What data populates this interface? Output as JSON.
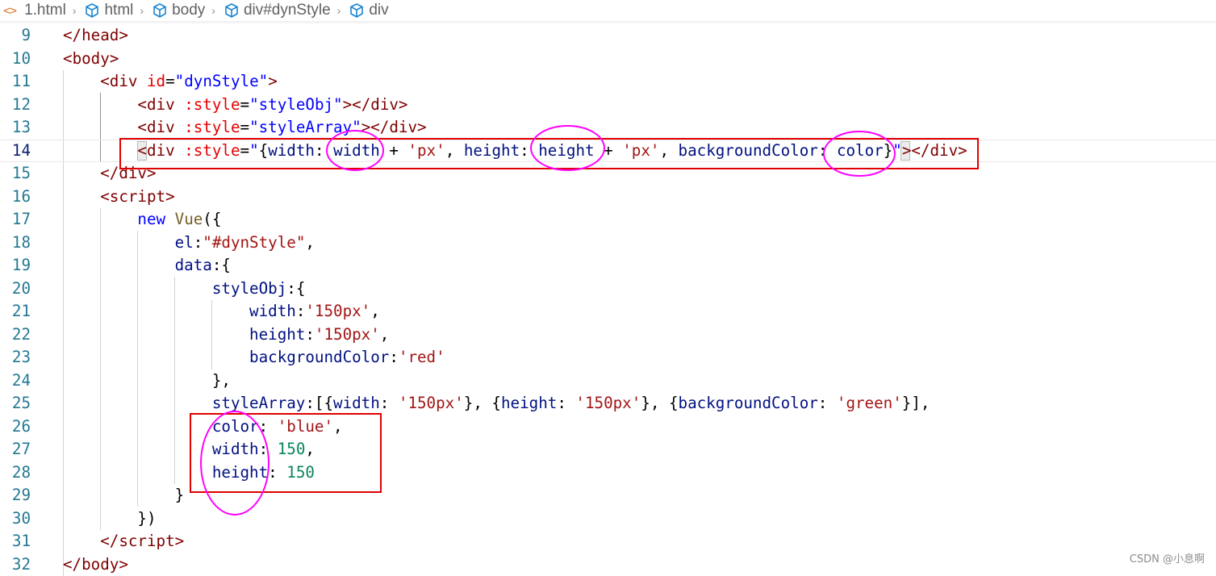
{
  "breadcrumb": {
    "file_icon": "<>",
    "file": "1.html",
    "items": [
      "html",
      "body",
      "div#dynStyle",
      "div"
    ],
    "separator": "›",
    "item_icon": "cube-icon"
  },
  "colors": {
    "tag": "#800000",
    "attribute": "#e50000",
    "attribute_value": "#0000ff",
    "keyword": "#0000ff",
    "function": "#795e26",
    "property": "#001080",
    "string": "#a31515",
    "number": "#098658",
    "line_number": "#237893",
    "annotation_box": "#e00000",
    "annotation_circle": "#ff00ff"
  },
  "editor": {
    "current_line": "14",
    "lines": [
      {
        "n": "9",
        "tokens": [
          [
            "</",
            "punc"
          ],
          [
            "head",
            "tag"
          ],
          [
            ">",
            "punc"
          ]
        ]
      },
      {
        "n": "10",
        "tokens": [
          [
            "<",
            "punc"
          ],
          [
            "body",
            "tag"
          ],
          [
            ">",
            "punc"
          ]
        ]
      },
      {
        "n": "11",
        "tokens": [
          [
            "    ",
            "plain"
          ],
          [
            "<",
            "punc"
          ],
          [
            "div",
            "tag"
          ],
          [
            " ",
            "plain"
          ],
          [
            "id",
            "attr"
          ],
          [
            "=",
            "plain"
          ],
          [
            "\"dynStyle\"",
            "str"
          ],
          [
            ">",
            "punc"
          ]
        ]
      },
      {
        "n": "12",
        "tokens": [
          [
            "        ",
            "plain"
          ],
          [
            "<",
            "punc"
          ],
          [
            "div",
            "tag"
          ],
          [
            " ",
            "plain"
          ],
          [
            ":style",
            "attr"
          ],
          [
            "=",
            "plain"
          ],
          [
            "\"styleObj\"",
            "str"
          ],
          [
            "></",
            "punc"
          ],
          [
            "div",
            "tag"
          ],
          [
            ">",
            "punc"
          ]
        ]
      },
      {
        "n": "13",
        "tokens": [
          [
            "        ",
            "plain"
          ],
          [
            "<",
            "punc"
          ],
          [
            "div",
            "tag"
          ],
          [
            " ",
            "plain"
          ],
          [
            ":style",
            "attr"
          ],
          [
            "=",
            "plain"
          ],
          [
            "\"styleArray\"",
            "str"
          ],
          [
            "></",
            "punc"
          ],
          [
            "div",
            "tag"
          ],
          [
            ">",
            "punc"
          ]
        ]
      },
      {
        "n": "14",
        "tokens": [
          [
            "        ",
            "plain"
          ],
          [
            "<",
            "punc"
          ],
          [
            "div",
            "tag"
          ],
          [
            " ",
            "plain"
          ],
          [
            ":style",
            "attr"
          ],
          [
            "=",
            "plain"
          ],
          [
            "\"",
            "str"
          ],
          [
            "{",
            "plain"
          ],
          [
            "width",
            "expr"
          ],
          [
            ": ",
            "plain"
          ],
          [
            "width",
            "expr"
          ],
          [
            " + ",
            "op"
          ],
          [
            "'px'",
            "jsstr"
          ],
          [
            ", ",
            "plain"
          ],
          [
            "height",
            "expr"
          ],
          [
            ": ",
            "plain"
          ],
          [
            "height",
            "expr"
          ],
          [
            " + ",
            "op"
          ],
          [
            "'px'",
            "jsstr"
          ],
          [
            ", ",
            "plain"
          ],
          [
            "backgroundColor",
            "expr"
          ],
          [
            ": ",
            "plain"
          ],
          [
            "color",
            "expr"
          ],
          [
            "}",
            "plain"
          ],
          [
            "\"",
            "str"
          ],
          [
            "></",
            "punc"
          ],
          [
            "div",
            "tag"
          ],
          [
            ">",
            "punc"
          ]
        ]
      },
      {
        "n": "15",
        "tokens": [
          [
            "    ",
            "plain"
          ],
          [
            "</",
            "punc"
          ],
          [
            "div",
            "tag"
          ],
          [
            ">",
            "punc"
          ]
        ]
      },
      {
        "n": "16",
        "tokens": [
          [
            "    ",
            "plain"
          ],
          [
            "<",
            "punc"
          ],
          [
            "script",
            "tag"
          ],
          [
            ">",
            "punc"
          ]
        ]
      },
      {
        "n": "17",
        "tokens": [
          [
            "        ",
            "plain"
          ],
          [
            "new",
            "kw"
          ],
          [
            " ",
            "plain"
          ],
          [
            "Vue",
            "fn"
          ],
          [
            "({",
            "plain"
          ]
        ]
      },
      {
        "n": "18",
        "tokens": [
          [
            "            ",
            "plain"
          ],
          [
            "el",
            "prop"
          ],
          [
            ":",
            "plain"
          ],
          [
            "\"#dynStyle\"",
            "jsstr"
          ],
          [
            ",",
            "plain"
          ]
        ]
      },
      {
        "n": "19",
        "tokens": [
          [
            "            ",
            "plain"
          ],
          [
            "data",
            "prop"
          ],
          [
            ":{",
            "plain"
          ]
        ]
      },
      {
        "n": "20",
        "tokens": [
          [
            "                ",
            "plain"
          ],
          [
            "styleObj",
            "prop"
          ],
          [
            ":{",
            "plain"
          ]
        ]
      },
      {
        "n": "21",
        "tokens": [
          [
            "                    ",
            "plain"
          ],
          [
            "width",
            "prop"
          ],
          [
            ":",
            "plain"
          ],
          [
            "'150px'",
            "jsstr"
          ],
          [
            ",",
            "plain"
          ]
        ]
      },
      {
        "n": "22",
        "tokens": [
          [
            "                    ",
            "plain"
          ],
          [
            "height",
            "prop"
          ],
          [
            ":",
            "plain"
          ],
          [
            "'150px'",
            "jsstr"
          ],
          [
            ",",
            "plain"
          ]
        ]
      },
      {
        "n": "23",
        "tokens": [
          [
            "                    ",
            "plain"
          ],
          [
            "backgroundColor",
            "prop"
          ],
          [
            ":",
            "plain"
          ],
          [
            "'red'",
            "jsstr"
          ]
        ]
      },
      {
        "n": "24",
        "tokens": [
          [
            "                ",
            "plain"
          ],
          [
            "},",
            "plain"
          ]
        ]
      },
      {
        "n": "25",
        "tokens": [
          [
            "                ",
            "plain"
          ],
          [
            "styleArray",
            "prop"
          ],
          [
            ":[{",
            "plain"
          ],
          [
            "width",
            "prop"
          ],
          [
            ": ",
            "plain"
          ],
          [
            "'150px'",
            "jsstr"
          ],
          [
            "}, {",
            "plain"
          ],
          [
            "height",
            "prop"
          ],
          [
            ": ",
            "plain"
          ],
          [
            "'150px'",
            "jsstr"
          ],
          [
            "}, {",
            "plain"
          ],
          [
            "backgroundColor",
            "prop"
          ],
          [
            ": ",
            "plain"
          ],
          [
            "'green'",
            "jsstr"
          ],
          [
            "}],",
            "plain"
          ]
        ]
      },
      {
        "n": "26",
        "tokens": [
          [
            "                ",
            "plain"
          ],
          [
            "color",
            "prop"
          ],
          [
            ": ",
            "plain"
          ],
          [
            "'blue'",
            "jsstr"
          ],
          [
            ",",
            "plain"
          ]
        ]
      },
      {
        "n": "27",
        "tokens": [
          [
            "                ",
            "plain"
          ],
          [
            "width",
            "prop"
          ],
          [
            ": ",
            "plain"
          ],
          [
            "150",
            "num"
          ],
          [
            ",",
            "plain"
          ]
        ]
      },
      {
        "n": "28",
        "tokens": [
          [
            "                ",
            "plain"
          ],
          [
            "height",
            "prop"
          ],
          [
            ": ",
            "plain"
          ],
          [
            "150",
            "num"
          ]
        ]
      },
      {
        "n": "29",
        "tokens": [
          [
            "            ",
            "plain"
          ],
          [
            "}",
            "plain"
          ]
        ]
      },
      {
        "n": "30",
        "tokens": [
          [
            "        ",
            "plain"
          ],
          [
            "})",
            "plain"
          ]
        ]
      },
      {
        "n": "31",
        "tokens": [
          [
            "    ",
            "plain"
          ],
          [
            "</",
            "punc"
          ],
          [
            "script",
            "tag"
          ],
          [
            ">",
            "punc"
          ]
        ]
      },
      {
        "n": "32",
        "tokens": [
          [
            "</",
            "punc"
          ],
          [
            "body",
            "tag"
          ],
          [
            ">",
            "punc"
          ]
        ]
      }
    ]
  },
  "watermark": "CSDN @小息啊"
}
